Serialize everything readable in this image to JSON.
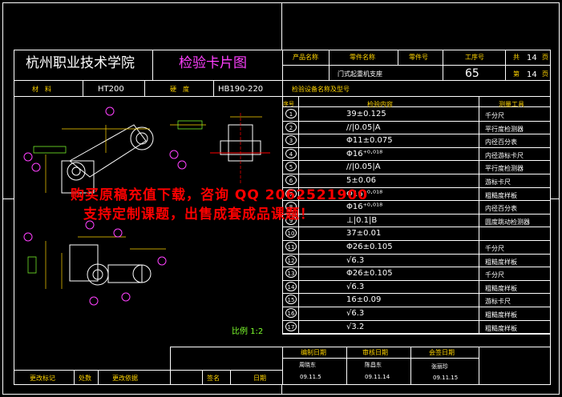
{
  "title_block": {
    "school": "杭州职业技术学院",
    "card_title": "检验卡片图",
    "product_name_label": "产品名称",
    "part_name_label": "零件名称",
    "part_no_label": "零件号",
    "process_no_label": "工序号",
    "total_label": "共",
    "total_value": "14",
    "page_unit": "页",
    "current_label": "第",
    "current_value": "14",
    "part_name_value": "门式起重机支座",
    "process_no_value": "65",
    "material_label": "材　料",
    "material_value": "HT200",
    "hardness_label": "硬　度",
    "hardness_value": "HB190-220",
    "equipment_label": "检验设备名称及型号",
    "seq_header": "序号",
    "content_header": "检验内容",
    "tool_header": "测量工具"
  },
  "inspection_rows": [
    {
      "no": "1",
      "content": "39±0.125",
      "tool": "千分尺"
    },
    {
      "no": "2",
      "content": "//|0.05|A",
      "tool": "平行度检测器"
    },
    {
      "no": "3",
      "content": "Φ11±0.075",
      "tool": "内径百分表"
    },
    {
      "no": "4",
      "content": "Φ16⁺⁰·⁰¹⁸",
      "tool": "内径游标卡尺"
    },
    {
      "no": "5",
      "content": "//|0.05|A",
      "tool": "平行度检测器"
    },
    {
      "no": "6",
      "content": "5±0.06",
      "tool": "游标卡尺"
    },
    {
      "no": "7",
      "content": "Φ16⁺⁰·⁰¹⁸",
      "tool": "粗糙度样板"
    },
    {
      "no": "8",
      "content": "Φ16⁺⁰·⁰¹⁸",
      "tool": "内径百分表"
    },
    {
      "no": "9",
      "content": "⊥|0.1|B",
      "tool": "圆度跳动检测器"
    },
    {
      "no": "10",
      "content": "37±0.01",
      "tool": ""
    },
    {
      "no": "11",
      "content": "Φ26±0.105",
      "tool": "千分尺"
    },
    {
      "no": "12",
      "content": "√6.3",
      "tool": "粗糙度样板"
    },
    {
      "no": "13",
      "content": "Φ26±0.105",
      "tool": "千分尺"
    },
    {
      "no": "14",
      "content": "√6.3",
      "tool": "粗糙度样板"
    },
    {
      "no": "15",
      "content": "16±0.09",
      "tool": "游标卡尺"
    },
    {
      "no": "16",
      "content": "√6.3",
      "tool": "粗糙度样板"
    },
    {
      "no": "17",
      "content": "√3.2",
      "tool": "粗糙度样板"
    }
  ],
  "drawing": {
    "scale_label": "比例 1:2"
  },
  "footer": {
    "design_date_label": "编制日期",
    "review_date_label": "审核日期",
    "approve_date_label": "会签日期",
    "designer": "周晓东",
    "design_date": "09.11.5",
    "reviewer": "陈昌东",
    "review_date": "09.11.14",
    "approver": "张丽珍",
    "approve_date": "09.11.15",
    "change_mark_label": "更改标记",
    "count_label": "处数",
    "change_basis_label": "更改依据",
    "sign_label": "签名",
    "date_label": "日期"
  },
  "watermark": {
    "line1": "购买原稿充值下载，咨询 QQ 2062521900",
    "line2": "支持定制课题，出售成套成品课题！"
  },
  "colors": {
    "background": "#000000",
    "line": "#ffffff",
    "accent_yellow": "#ffd400",
    "accent_magenta": "#ff40ff",
    "accent_green": "#7dff2d",
    "watermark": "#ff0000"
  }
}
